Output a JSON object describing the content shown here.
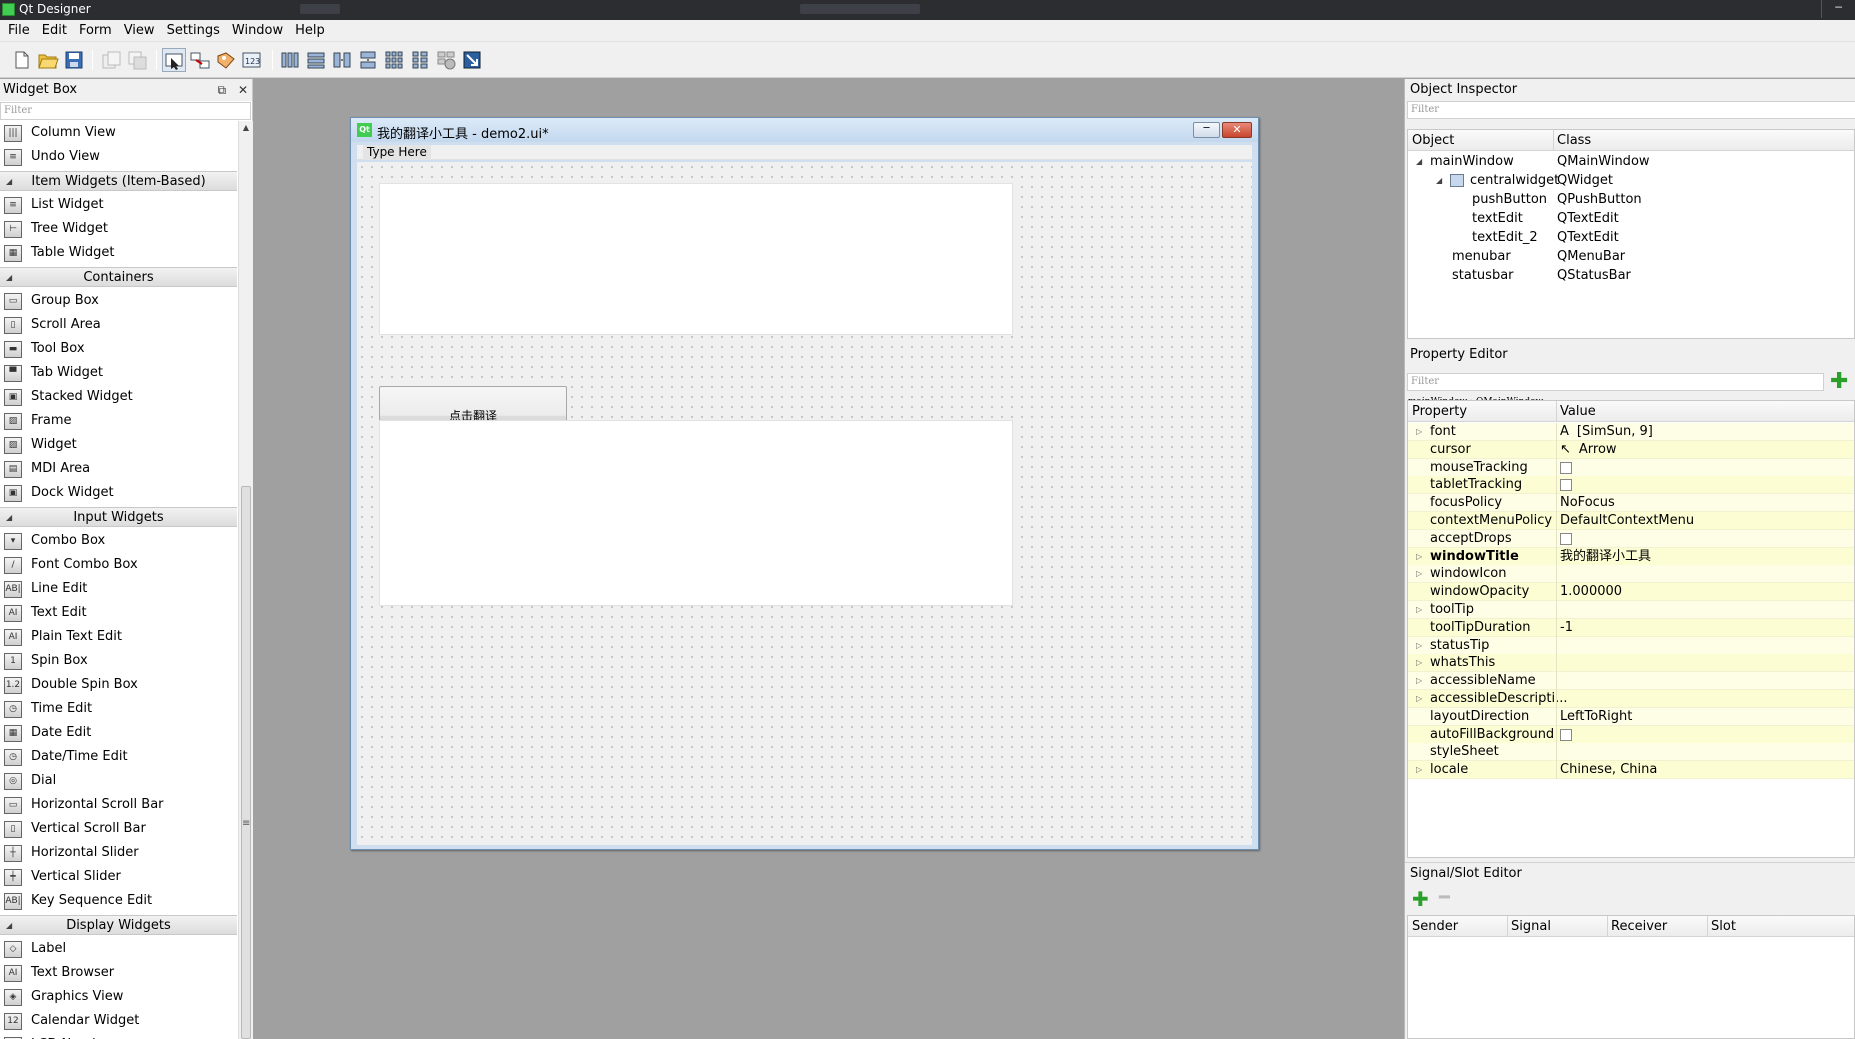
{
  "app": {
    "title": "Qt Designer",
    "window_buttons": [
      "─"
    ]
  },
  "menubar": [
    "File",
    "Edit",
    "Form",
    "View",
    "Settings",
    "Window",
    "Help"
  ],
  "widget_box": {
    "title": "Widget Box",
    "float_glyph": "⧉",
    "close_glyph": "✕",
    "filter_placeholder": "Filter",
    "items": [
      {
        "kind": "item",
        "label": "Column View",
        "icon": "column-view-icon",
        "glyph": "|||"
      },
      {
        "kind": "item",
        "label": "Undo View",
        "icon": "undo-view-icon",
        "glyph": "≡"
      },
      {
        "kind": "category",
        "label": "Item Widgets (Item-Based)"
      },
      {
        "kind": "item",
        "label": "List Widget",
        "icon": "list-widget-icon",
        "glyph": "≡"
      },
      {
        "kind": "item",
        "label": "Tree Widget",
        "icon": "tree-widget-icon",
        "glyph": "⊢"
      },
      {
        "kind": "item",
        "label": "Table Widget",
        "icon": "table-widget-icon",
        "glyph": "▦"
      },
      {
        "kind": "category",
        "label": "Containers"
      },
      {
        "kind": "item",
        "label": "Group Box",
        "icon": "group-box-icon",
        "glyph": "▭"
      },
      {
        "kind": "item",
        "label": "Scroll Area",
        "icon": "scroll-area-icon",
        "glyph": "▯"
      },
      {
        "kind": "item",
        "label": "Tool Box",
        "icon": "tool-box-icon",
        "glyph": "▬"
      },
      {
        "kind": "item",
        "label": "Tab Widget",
        "icon": "tab-widget-icon",
        "glyph": "▀"
      },
      {
        "kind": "item",
        "label": "Stacked Widget",
        "icon": "stacked-widget-icon",
        "glyph": "▣"
      },
      {
        "kind": "item",
        "label": "Frame",
        "icon": "frame-icon",
        "glyph": "▨"
      },
      {
        "kind": "item",
        "label": "Widget",
        "icon": "widget-icon",
        "glyph": "▨"
      },
      {
        "kind": "item",
        "label": "MDI Area",
        "icon": "mdi-area-icon",
        "glyph": "▤"
      },
      {
        "kind": "item",
        "label": "Dock Widget",
        "icon": "dock-widget-icon",
        "glyph": "▣"
      },
      {
        "kind": "category",
        "label": "Input Widgets"
      },
      {
        "kind": "item",
        "label": "Combo Box",
        "icon": "combo-box-icon",
        "glyph": "▾"
      },
      {
        "kind": "item",
        "label": "Font Combo Box",
        "icon": "font-combo-box-icon",
        "glyph": "/"
      },
      {
        "kind": "item",
        "label": "Line Edit",
        "icon": "line-edit-icon",
        "glyph": "AB|"
      },
      {
        "kind": "item",
        "label": "Text Edit",
        "icon": "text-edit-icon",
        "glyph": "AI"
      },
      {
        "kind": "item",
        "label": "Plain Text Edit",
        "icon": "plain-text-edit-icon",
        "glyph": "AI"
      },
      {
        "kind": "item",
        "label": "Spin Box",
        "icon": "spin-box-icon",
        "glyph": "1"
      },
      {
        "kind": "item",
        "label": "Double Spin Box",
        "icon": "double-spin-box-icon",
        "glyph": "1.2"
      },
      {
        "kind": "item",
        "label": "Time Edit",
        "icon": "time-edit-icon",
        "glyph": "◷"
      },
      {
        "kind": "item",
        "label": "Date Edit",
        "icon": "date-edit-icon",
        "glyph": "▦"
      },
      {
        "kind": "item",
        "label": "Date/Time Edit",
        "icon": "date-time-edit-icon",
        "glyph": "◷"
      },
      {
        "kind": "item",
        "label": "Dial",
        "icon": "dial-icon",
        "glyph": "◎"
      },
      {
        "kind": "item",
        "label": "Horizontal Scroll Bar",
        "icon": "horizontal-scroll-bar-icon",
        "glyph": "▭"
      },
      {
        "kind": "item",
        "label": "Vertical Scroll Bar",
        "icon": "vertical-scroll-bar-icon",
        "glyph": "▯"
      },
      {
        "kind": "item",
        "label": "Horizontal Slider",
        "icon": "horizontal-slider-icon",
        "glyph": "┼"
      },
      {
        "kind": "item",
        "label": "Vertical Slider",
        "icon": "vertical-slider-icon",
        "glyph": "┿"
      },
      {
        "kind": "item",
        "label": "Key Sequence Edit",
        "icon": "key-sequence-edit-icon",
        "glyph": "AB|"
      },
      {
        "kind": "category",
        "label": "Display Widgets"
      },
      {
        "kind": "item",
        "label": "Label",
        "icon": "label-icon",
        "glyph": "◇"
      },
      {
        "kind": "item",
        "label": "Text Browser",
        "icon": "text-browser-icon",
        "glyph": "AI"
      },
      {
        "kind": "item",
        "label": "Graphics View",
        "icon": "graphics-view-icon",
        "glyph": "◈"
      },
      {
        "kind": "item",
        "label": "Calendar Widget",
        "icon": "calendar-widget-icon",
        "glyph": "12"
      },
      {
        "kind": "item",
        "label": "LCD Number",
        "icon": "lcd-number-icon",
        "glyph": "8"
      }
    ]
  },
  "form_window": {
    "title": "我的翻译小工具 - demo2.ui*",
    "qt_badge": "Qt",
    "minimize_glyph": "─",
    "close_glyph": "✕",
    "menu_placeholder": "Type Here",
    "push_button_text": "点击翻译"
  },
  "object_inspector": {
    "title": "Object Inspector",
    "filter_placeholder": "Filter",
    "columns": [
      "Object",
      "Class"
    ],
    "rows": [
      {
        "object": "mainWindow",
        "class": "QMainWindow"
      },
      {
        "object": "centralwidget",
        "class": "QWidget"
      },
      {
        "object": "pushButton",
        "class": "QPushButton"
      },
      {
        "object": "textEdit",
        "class": "QTextEdit"
      },
      {
        "object": "textEdit_2",
        "class": "QTextEdit"
      },
      {
        "object": "menubar",
        "class": "QMenuBar"
      },
      {
        "object": "statusbar",
        "class": "QStatusBar"
      }
    ]
  },
  "property_editor": {
    "title": "Property Editor",
    "filter_placeholder": "Filter",
    "context": "mainWindow : QMainWindow",
    "columns": [
      "Property",
      "Value"
    ],
    "rows": [
      {
        "name": "font",
        "value": "[SimSun, 9]",
        "expandable": true,
        "prefix": "A"
      },
      {
        "name": "cursor",
        "value": "Arrow",
        "prefix": "↖"
      },
      {
        "name": "mouseTracking",
        "checkbox": true
      },
      {
        "name": "tabletTracking",
        "checkbox": true
      },
      {
        "name": "focusPolicy",
        "value": "NoFocus"
      },
      {
        "name": "contextMenuPolicy",
        "value": "DefaultContextMenu"
      },
      {
        "name": "acceptDrops",
        "checkbox": true
      },
      {
        "name": "windowTitle",
        "value": "我的翻译小工具",
        "expandable": true,
        "bold": true
      },
      {
        "name": "windowIcon",
        "value": "",
        "expandable": true
      },
      {
        "name": "windowOpacity",
        "value": "1.000000"
      },
      {
        "name": "toolTip",
        "value": "",
        "expandable": true
      },
      {
        "name": "toolTipDuration",
        "value": "-1"
      },
      {
        "name": "statusTip",
        "value": "",
        "expandable": true
      },
      {
        "name": "whatsThis",
        "value": "",
        "expandable": true
      },
      {
        "name": "accessibleName",
        "value": "",
        "expandable": true
      },
      {
        "name": "accessibleDescripti...",
        "value": "",
        "expandable": true
      },
      {
        "name": "layoutDirection",
        "value": "LeftToRight"
      },
      {
        "name": "autoFillBackground",
        "checkbox": true
      },
      {
        "name": "styleSheet",
        "value": ""
      },
      {
        "name": "locale",
        "value": "Chinese, China",
        "expandable": true
      }
    ]
  },
  "signal_slot_editor": {
    "title": "Signal/Slot Editor",
    "add_glyph": "✚",
    "remove_glyph": "━",
    "columns": [
      "Sender",
      "Signal",
      "Receiver",
      "Slot"
    ]
  }
}
